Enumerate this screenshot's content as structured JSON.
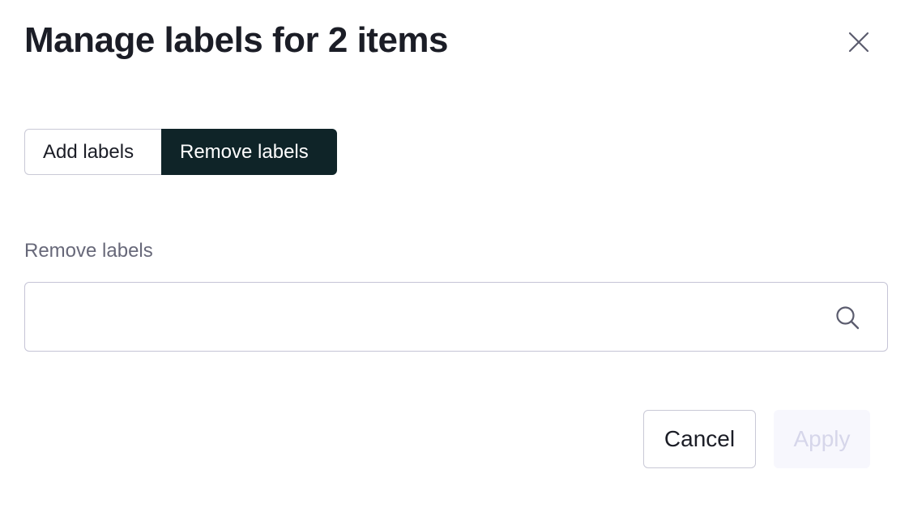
{
  "dialog": {
    "title": "Manage labels for 2 items",
    "close_icon": "close-icon"
  },
  "mode_toggle": {
    "options": [
      {
        "label": "Add labels",
        "selected": false
      },
      {
        "label": "Remove labels",
        "selected": true
      }
    ]
  },
  "remove_field": {
    "label": "Remove labels",
    "value": "",
    "placeholder": "",
    "icon": "search-icon"
  },
  "actions": {
    "cancel_label": "Cancel",
    "apply_label": "Apply",
    "apply_disabled": true
  },
  "colors": {
    "active_segment_bg": "#0f2428",
    "title_text": "#1b1d26",
    "label_text": "#676879",
    "disabled_text": "#d6d6ea",
    "border": "#c9c9d6"
  }
}
